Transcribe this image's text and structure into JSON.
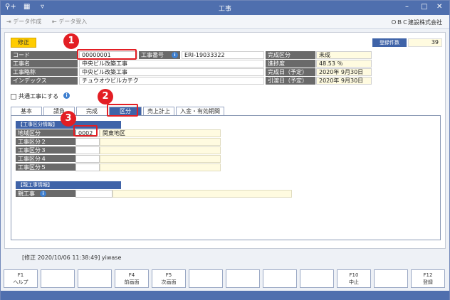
{
  "window": {
    "title": "工事"
  },
  "toolbar": {
    "create_label": "データ作成",
    "receive_label": "データ受入",
    "company": "ＯＢＣ建設株式会社"
  },
  "header": {
    "mode": "修正",
    "count_label": "登録件数",
    "count_value": "39"
  },
  "fields": {
    "code_label": "コード",
    "code_value": "00000001",
    "koji_no_label": "工事番号",
    "koji_no_value": "ERI-19033322",
    "name_label": "工事名",
    "name_value": "中央ビル改築工事",
    "short_label": "工事略称",
    "short_value": "中央ビル改築工事",
    "index_label": "インデックス",
    "index_value": "チュウオウビルカチク",
    "complete_kbn_label": "完成区分",
    "complete_kbn_value": "未成",
    "progress_label": "進捗度",
    "progress_value": "48.53 ％",
    "complete_date_label": "完成日（予定）",
    "complete_date_value": "2020年 9月30日",
    "delivery_date_label": "引渡日（予定）",
    "delivery_date_value": "2020年 9月30日"
  },
  "common": {
    "label": "共通工事にする"
  },
  "tabs": [
    "基本",
    "請負",
    "完成",
    "区分",
    "売上計上",
    "入金・有効期間"
  ],
  "kubun": {
    "section_title": "【工事区分情報】",
    "rows": [
      {
        "label": "地域区分",
        "code": "0002",
        "name": "関東地区"
      },
      {
        "label": "工事区分２",
        "code": "",
        "name": ""
      },
      {
        "label": "工事区分３",
        "code": "",
        "name": ""
      },
      {
        "label": "工事区分４",
        "code": "",
        "name": ""
      },
      {
        "label": "工事区分５",
        "code": "",
        "name": ""
      }
    ]
  },
  "parent": {
    "section_title": "【親工事情報】",
    "label": "親工事"
  },
  "status": {
    "text": "[修正 2020/10/06 11:38:49] yiwase"
  },
  "fkeys": [
    {
      "key": "F1",
      "label": "ヘルプ"
    },
    {
      "key": "",
      "label": ""
    },
    {
      "key": "",
      "label": ""
    },
    {
      "key": "F4",
      "label": "前画面"
    },
    {
      "key": "F5",
      "label": "次画面"
    },
    {
      "key": "",
      "label": ""
    },
    {
      "key": "",
      "label": ""
    },
    {
      "key": "",
      "label": ""
    },
    {
      "key": "",
      "label": ""
    },
    {
      "key": "F10",
      "label": "中止"
    },
    {
      "key": "",
      "label": ""
    },
    {
      "key": "F12",
      "label": "登録"
    }
  ],
  "callouts": [
    "1",
    "2",
    "3"
  ],
  "colors": {
    "accent": "#3f63a8",
    "highlight": "#e31e24",
    "mode": "#ffcc00"
  }
}
